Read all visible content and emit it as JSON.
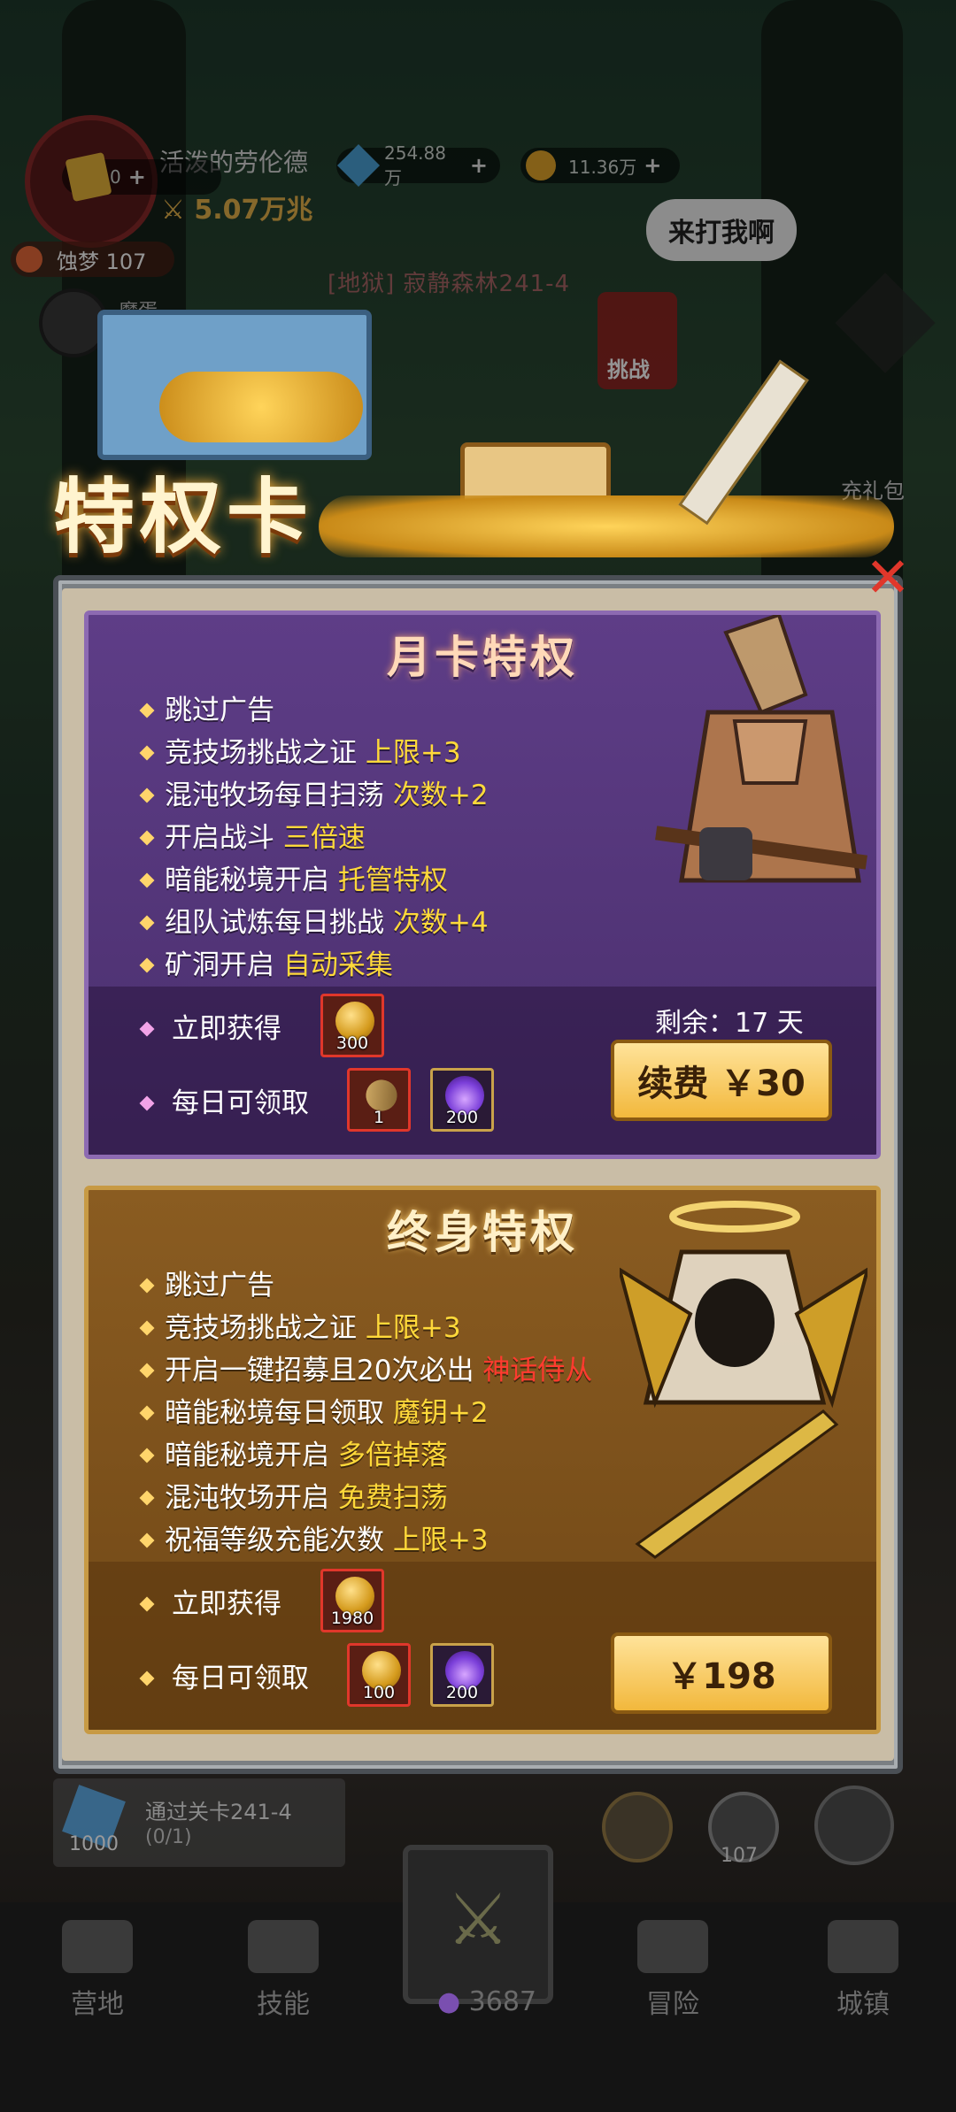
{
  "hud": {
    "player_name": "活泼的劳伦德",
    "ticket_count": "0",
    "power": "5.07万兆",
    "crystal": "254.88万",
    "gold": "11.36万",
    "nightmare": "蚀梦 107",
    "pet_label": "魔蛋",
    "stage": "[地狱] 寂静森林241-4",
    "speech": "来打我啊",
    "challenge": "挑战",
    "gift": "充礼包"
  },
  "banner": {
    "title": "特权卡"
  },
  "month_card": {
    "title": "月卡特权",
    "perks": [
      {
        "text": "跳过广告",
        "highlight": ""
      },
      {
        "text": "竞技场挑战之证 ",
        "highlight": "上限+3"
      },
      {
        "text": "混沌牧场每日扫荡 ",
        "highlight": "次数+2"
      },
      {
        "text": "开启战斗 ",
        "highlight": "三倍速"
      },
      {
        "text": "暗能秘境开启 ",
        "highlight": "托管特权"
      },
      {
        "text": "组队试炼每日挑战 ",
        "highlight": "次数+4"
      },
      {
        "text": "矿洞开启 ",
        "highlight": "自动采集"
      }
    ],
    "instant_label": "立即获得",
    "daily_label": "每日可领取",
    "instant_items": [
      {
        "icon": "gold-coin-icon",
        "count": "300"
      }
    ],
    "daily_items": [
      {
        "icon": "key-icon",
        "count": "1"
      },
      {
        "icon": "purple-flame-icon",
        "count": "200"
      }
    ],
    "remaining": "剩余：17 天",
    "button": "续费 ￥30"
  },
  "life_card": {
    "title": "终身特权",
    "perks": [
      {
        "text": "跳过广告",
        "highlight": "",
        "red": ""
      },
      {
        "text": "竞技场挑战之证 ",
        "highlight": "上限+3",
        "red": ""
      },
      {
        "text": "开启一键招募且20次必出 ",
        "highlight": "",
        "red": "神话侍从"
      },
      {
        "text": "暗能秘境每日领取 ",
        "highlight": "魔钥+2",
        "red": ""
      },
      {
        "text": "暗能秘境开启 ",
        "highlight": "多倍掉落",
        "red": ""
      },
      {
        "text": "混沌牧场开启 ",
        "highlight": "免费扫荡",
        "red": ""
      },
      {
        "text": "祝福等级充能次数 ",
        "highlight": "上限+3",
        "red": ""
      }
    ],
    "instant_label": "立即获得",
    "daily_label": "每日可领取",
    "instant_items": [
      {
        "icon": "gold-coin-icon",
        "count": "1980"
      }
    ],
    "daily_items": [
      {
        "icon": "gold-coin-icon",
        "count": "100"
      },
      {
        "icon": "purple-flame-icon",
        "count": "200"
      }
    ],
    "button": "￥198"
  },
  "quest": {
    "reward": "1000",
    "text": "通过关卡241-4",
    "progress": "(0/1)",
    "gear_count": "107"
  },
  "nav": {
    "items": [
      "营地",
      "技能",
      "冒险",
      "城镇"
    ],
    "center_count": "3687"
  },
  "colors": {
    "highlight": "#ffd93a",
    "red": "#ff3b2f",
    "month_bg": "#5e3d87",
    "life_bg": "#8a5c21"
  }
}
